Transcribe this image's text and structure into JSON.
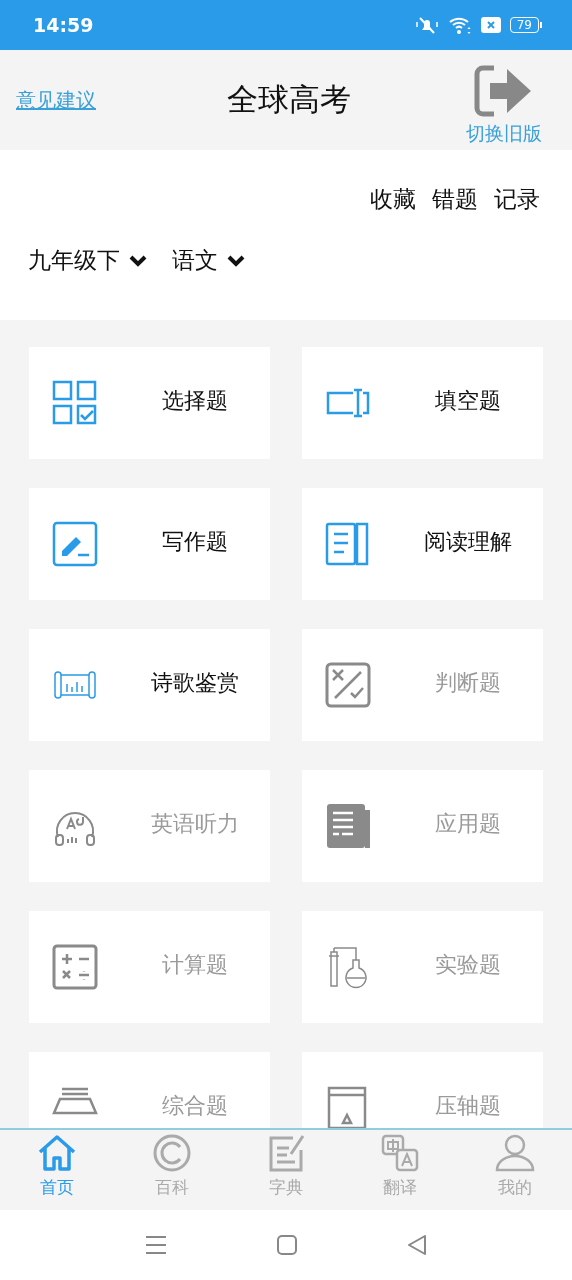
{
  "status_bar": {
    "time": "14:59",
    "battery": "79"
  },
  "header": {
    "feedback_link": "意见建议",
    "title": "全球高考",
    "switch_label": "切换旧版"
  },
  "quick_links": [
    "收藏",
    "错题",
    "记录"
  ],
  "filters": [
    {
      "label": "九年级下"
    },
    {
      "label": "语文"
    }
  ],
  "categories": [
    {
      "label": "选择题",
      "disabled": false
    },
    {
      "label": "填空题",
      "disabled": false
    },
    {
      "label": "写作题",
      "disabled": false
    },
    {
      "label": "阅读理解",
      "disabled": false
    },
    {
      "label": "诗歌鉴赏",
      "disabled": false
    },
    {
      "label": "判断题",
      "disabled": true
    },
    {
      "label": "英语听力",
      "disabled": true
    },
    {
      "label": "应用题",
      "disabled": true
    },
    {
      "label": "计算题",
      "disabled": true
    },
    {
      "label": "实验题",
      "disabled": true
    },
    {
      "label": "综合题",
      "disabled": true
    },
    {
      "label": "压轴题",
      "disabled": true
    }
  ],
  "bottom_nav": [
    {
      "label": "首页",
      "selected": true
    },
    {
      "label": "百科",
      "selected": false
    },
    {
      "label": "字典",
      "selected": false
    },
    {
      "label": "翻译",
      "selected": false
    },
    {
      "label": "我的",
      "selected": false
    }
  ]
}
